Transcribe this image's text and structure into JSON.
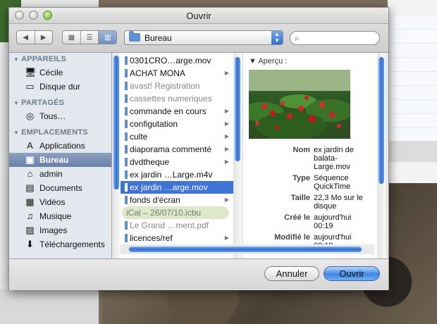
{
  "window": {
    "title": "Ouvrir"
  },
  "toolbar": {
    "location": "Bureau",
    "search_placeholder": ""
  },
  "sidebar": {
    "sections": [
      {
        "title": "APPAREILS",
        "items": [
          {
            "label": "Cécile",
            "icon": "computer-icon"
          },
          {
            "label": "Disque dur",
            "icon": "hard-disk-icon"
          }
        ]
      },
      {
        "title": "PARTAGÉS",
        "items": [
          {
            "label": "Tous…",
            "icon": "network-icon"
          }
        ]
      },
      {
        "title": "EMPLACEMENTS",
        "items": [
          {
            "label": "Applications",
            "icon": "applications-icon"
          },
          {
            "label": "Bureau",
            "icon": "desktop-icon",
            "selected": true
          },
          {
            "label": "admin",
            "icon": "home-icon"
          },
          {
            "label": "Documents",
            "icon": "documents-icon"
          },
          {
            "label": "Vidéos",
            "icon": "movies-icon"
          },
          {
            "label": "Musique",
            "icon": "music-icon"
          },
          {
            "label": "Images",
            "icon": "pictures-icon"
          },
          {
            "label": "Téléchargements",
            "icon": "downloads-icon"
          }
        ]
      }
    ]
  },
  "files": [
    {
      "name": "0301CRO…arge.mov",
      "folder": false
    },
    {
      "name": "ACHAT MONA",
      "folder": true
    },
    {
      "name": "avast! Registration",
      "folder": false,
      "dim": true
    },
    {
      "name": "cassettes numeriques",
      "folder": false,
      "dim": true
    },
    {
      "name": "commande en cours",
      "folder": true
    },
    {
      "name": "configutation",
      "folder": true
    },
    {
      "name": "culte",
      "folder": true
    },
    {
      "name": "diaporama commenté",
      "folder": true
    },
    {
      "name": "dvdtheque",
      "folder": true
    },
    {
      "name": "ex jardin …Large.m4v",
      "folder": false
    },
    {
      "name": "ex jardin …arge.mov",
      "folder": false,
      "selected": true
    },
    {
      "name": "fonds d'écran",
      "folder": true
    },
    {
      "name": "iCal – 26/07/10.icbu",
      "folder": false,
      "ical": true
    },
    {
      "name": "Le Grand …ment.pdf",
      "folder": false,
      "dim": true
    },
    {
      "name": "licences/ref",
      "folder": true
    }
  ],
  "preview": {
    "label": "Aperçu :",
    "fields": [
      {
        "key": "Nom",
        "value": "ex jardin de balata-Large.mov"
      },
      {
        "key": "Type",
        "value": "Séquence QuickTime"
      },
      {
        "key": "Taille",
        "value": "22,3 Mo sur le disque"
      },
      {
        "key": "Créé le",
        "value": "aujourd'hui 00:19"
      },
      {
        "key": "Modifié le",
        "value": "aujourd'hui 00:19"
      }
    ]
  },
  "buttons": {
    "cancel": "Annuler",
    "open": "Ouvrir"
  }
}
